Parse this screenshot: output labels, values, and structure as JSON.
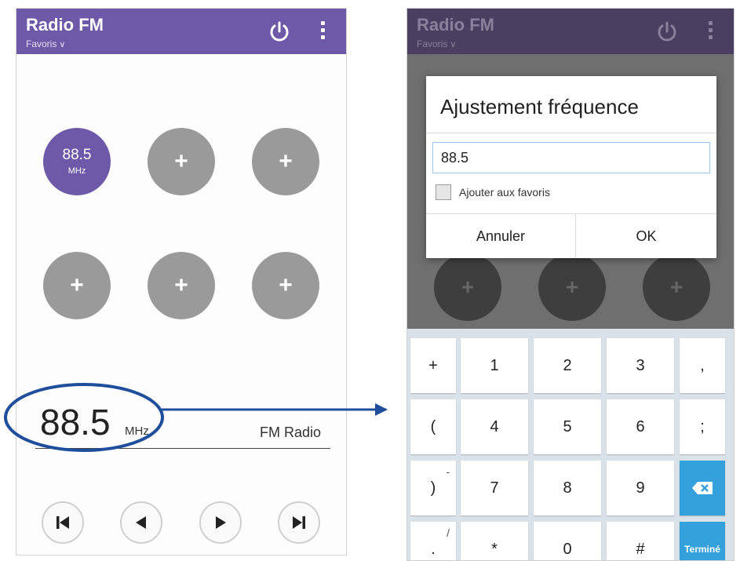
{
  "left_screen": {
    "appbar": {
      "title": "Radio FM",
      "subtitle": "Favoris",
      "color": "#6e58a8"
    },
    "presets": [
      {
        "frequency": "88.5",
        "unit": "MHz"
      },
      {
        "label": "+"
      },
      {
        "label": "+"
      },
      {
        "label": "+"
      },
      {
        "label": "+"
      },
      {
        "label": "+"
      }
    ],
    "now_playing": {
      "frequency": "88.5",
      "unit": "MHz",
      "source": "FM Radio"
    },
    "controls": [
      "skip-previous-icon",
      "previous-icon",
      "play-icon",
      "skip-next-icon"
    ]
  },
  "right_screen": {
    "appbar": {
      "title": "Radio FM",
      "subtitle": "Favoris"
    },
    "dimmed_presets": [
      "+",
      "+",
      "+"
    ],
    "dialog": {
      "title": "Ajustement fréquence",
      "input_value": "88.5",
      "checkbox_label": "Ajouter aux favoris",
      "checkbox_checked": false,
      "cancel_label": "Annuler",
      "ok_label": "OK"
    },
    "keyboard": {
      "rows": [
        [
          "+",
          "1",
          "2",
          "3",
          ","
        ],
        [
          "(",
          "4",
          "5",
          "6",
          ";"
        ],
        [
          ")",
          "7",
          "8",
          "9",
          "⌫"
        ],
        [
          ".",
          "*",
          "0",
          "#",
          "Terminé"
        ]
      ],
      "alt_chars": {
        "paren": "-",
        "dot": "/"
      },
      "accent_color": "#34a0dc"
    }
  },
  "annotation": {
    "highlight_color": "#1f4e9c"
  }
}
